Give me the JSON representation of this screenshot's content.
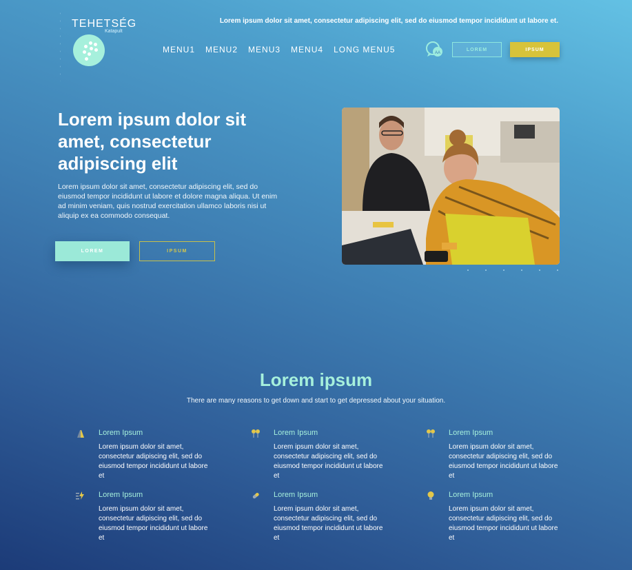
{
  "logo": {
    "name": "TEHETSÉG",
    "sub": "Katapult"
  },
  "header": {
    "tagline": "Lorem ipsum dolor sit amet, consectetur adipiscing elit, sed do eiusmod tempor incididunt ut labore et.",
    "menu": [
      "MENU1",
      "MENU2",
      "MENU3",
      "MENU4",
      "LONG MENU5"
    ],
    "btn_lorem": "LOREM",
    "btn_ipsum": "IPSUM"
  },
  "hero": {
    "title": "Lorem ipsum dolor sit amet, consectetur adipiscing elit",
    "text": "Lorem ipsum dolor sit amet, consectetur adipiscing elit, sed do eiusmod tempor incididunt ut labore et dolore magna aliqua. Ut enim ad minim veniam, quis nostrud exercitation ullamco laboris nisi ut aliquip ex ea commodo consequat.",
    "btn_lorem": "LOREM",
    "btn_ipsum": "IPSUM"
  },
  "section": {
    "title": "Lorem ipsum",
    "subtitle": "There are many reasons to get down and start to get depressed about your situation."
  },
  "features": [
    {
      "icon": "traffic-cone-icon",
      "title": "Lorem Ipsum",
      "text": "Lorem ipsum dolor sit amet, consectetur adipiscing elit, sed do eiusmod tempor incididunt ut labore et"
    },
    {
      "icon": "pins-icon",
      "title": "Lorem Ipsum",
      "text": "Lorem ipsum dolor sit amet, consectetur adipiscing elit, sed do eiusmod tempor incididunt ut labore et"
    },
    {
      "icon": "pins-icon",
      "title": "Lorem Ipsum",
      "text": "Lorem ipsum dolor sit amet, consectetur adipiscing elit, sed do eiusmod tempor incididunt ut labore et"
    },
    {
      "icon": "lightning-icon",
      "title": "Lorem Ipsum",
      "text": "Lorem ipsum dolor sit amet, consectetur adipiscing elit, sed do eiusmod tempor incididunt ut labore et"
    },
    {
      "icon": "pill-icon",
      "title": "Lorem Ipsum",
      "text": "Lorem ipsum dolor sit amet, consectetur adipiscing elit, sed do eiusmod tempor incididunt ut labore et"
    },
    {
      "icon": "lightbulb-icon",
      "title": "Lorem Ipsum",
      "text": "Lorem ipsum dolor sit amet, consectetur adipiscing elit, sed do eiusmod tempor incididunt ut labore et"
    }
  ],
  "colors": {
    "accent_mint": "#a6f0dc",
    "accent_yellow": "#d7c33a",
    "bg_top": "#63c1e4",
    "bg_bottom": "#1c3b78"
  }
}
